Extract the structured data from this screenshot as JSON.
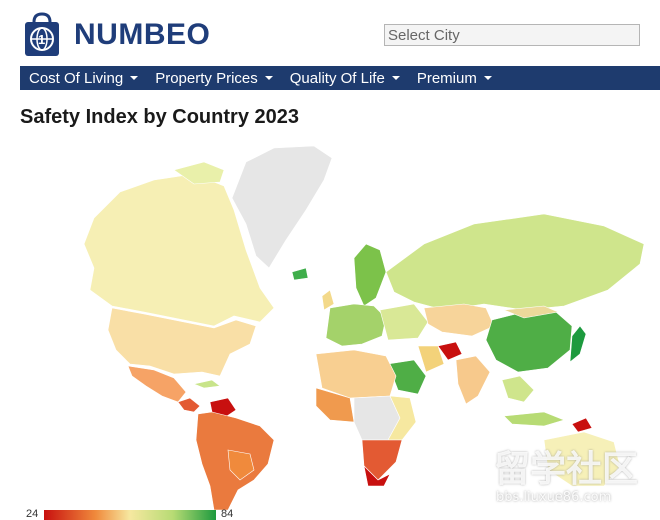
{
  "brand": {
    "name": "NUMBEO",
    "logo_icon": "shopping-bag-globe-icon"
  },
  "search": {
    "placeholder": "Select City"
  },
  "nav": {
    "items": [
      {
        "label": "Cost Of Living",
        "icon": "caret-down-icon"
      },
      {
        "label": "Property Prices",
        "icon": "caret-down-icon"
      },
      {
        "label": "Quality Of Life",
        "icon": "caret-down-icon"
      },
      {
        "label": "Premium",
        "icon": "caret-down-icon"
      }
    ]
  },
  "page": {
    "title": "Safety Index by Country 2023"
  },
  "legend": {
    "min": "24",
    "max": "84",
    "colors": [
      "#c8100f",
      "#f08a3c",
      "#f6e8a0",
      "#b7db74",
      "#1d9a3e"
    ]
  },
  "watermark": {
    "main": "留学社区",
    "url": "bbs.liuxue86.com"
  },
  "colors": {
    "nav_bg": "#1e3b6e",
    "brand": "#1f3d7a",
    "no_data": "#e6e6e6"
  }
}
